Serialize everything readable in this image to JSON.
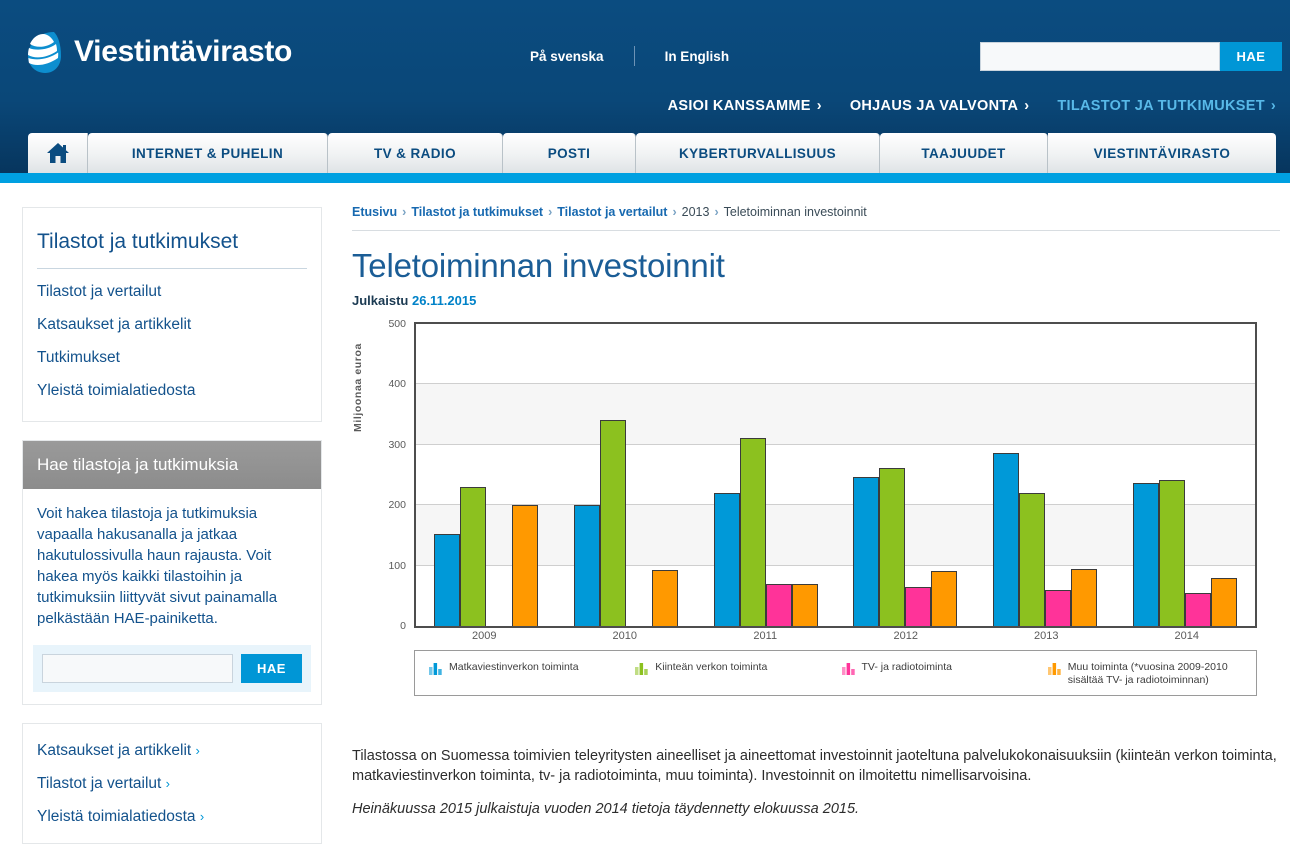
{
  "header": {
    "brand": "Viestintävirasto",
    "lang_sv": "På svenska",
    "lang_en": "In English",
    "search_placeholder": "",
    "search_value": "",
    "search_button": "HAE",
    "topnav": [
      {
        "label": "ASIOI KANSSAMME",
        "chev": "›",
        "active": false
      },
      {
        "label": "OHJAUS JA VALVONTA",
        "chev": "›",
        "active": false
      },
      {
        "label": "TILASTOT JA TUTKIMUKSET",
        "chev": "›",
        "active": true
      }
    ],
    "tabs": [
      {
        "label": "INTERNET & PUHELIN"
      },
      {
        "label": "TV & RADIO"
      },
      {
        "label": "POSTI"
      },
      {
        "label": "KYBERTURVALLISUUS"
      },
      {
        "label": "TAAJUUDET"
      },
      {
        "label": "VIESTINTÄVIRASTO"
      }
    ],
    "home_tab_name": "home-tab"
  },
  "sidebar": {
    "title": "Tilastot ja tutkimukset",
    "links": [
      "Tilastot ja vertailut",
      "Katsaukset ja artikkelit",
      "Tutkimukset",
      "Yleistä toimialatiedosta"
    ],
    "search_card": {
      "heading": "Hae tilastoja ja tutkimuksia",
      "description": "Voit hakea tilastoja ja tutkimuksia vapaalla hakusanalla ja jatkaa hakutulossivulla haun rajausta. Voit hakea myös kaikki tilastoihin ja tutkimuksiin liittyvät sivut painamalla pelkästään HAE-painiketta.",
      "input_value": "",
      "input_placeholder": "",
      "button": "HAE"
    },
    "quick_links": [
      {
        "label": "Katsaukset ja artikkelit",
        "arrow": "›"
      },
      {
        "label": "Tilastot ja vertailut",
        "arrow": "›"
      },
      {
        "label": "Yleistä toimialatiedosta",
        "arrow": "›"
      }
    ]
  },
  "content": {
    "breadcrumb": [
      {
        "label": "Etusivu",
        "link": true
      },
      {
        "label": "Tilastot ja tutkimukset",
        "link": true
      },
      {
        "label": "Tilastot ja vertailut",
        "link": true
      },
      {
        "label": "2013",
        "link": false
      },
      {
        "label": "Teletoiminnan investoinnit",
        "link": false
      }
    ],
    "breadcrumb_sep": "›",
    "title": "Teletoiminnan investoinnit",
    "published_label": "Julkaistu",
    "published_date": "26.11.2015",
    "paragraph": "Tilastossa on Suomessa toimivien teleyritysten aineelliset ja aineettomat investoinnit jaoteltuna palvelukokonaisuuksiin (kiinteän verkon toiminta, matkaviestinverkon toiminta, tv- ja radiotoiminta, muu toiminta). Investoinnit on ilmoitettu nimellisarvoisina.",
    "note": "Heinäkuussa 2015 julkaistuja vuoden 2014 tietoja täydennetty elokuussa 2015."
  },
  "chart_data": {
    "type": "bar",
    "title": "",
    "xlabel": "",
    "ylabel": "Miljoonaa euroa",
    "categories": [
      "2009",
      "2010",
      "2011",
      "2012",
      "2013",
      "2014"
    ],
    "ylim": [
      0,
      500
    ],
    "yticks": [
      0,
      100,
      200,
      300,
      400,
      500
    ],
    "ytick_labels": [
      "0",
      "100",
      "200",
      "300",
      "400",
      "500"
    ],
    "grid": true,
    "legend_position": "bottom",
    "series": [
      {
        "name": "Matkaviestinverkon toiminta",
        "color": "#0099d8",
        "values": [
          152,
          200,
          220,
          247,
          287,
          236
        ]
      },
      {
        "name": "Kiinteän verkon toiminta",
        "color": "#8cc11f",
        "values": [
          230,
          341,
          311,
          262,
          220,
          241
        ]
      },
      {
        "name": "TV- ja radiotoiminta",
        "color": "#ff3399",
        "values": [
          null,
          null,
          69,
          65,
          60,
          55
        ]
      },
      {
        "name": "Muu toiminta (*vuosina 2009-2010 sisältää TV- ja radiotoiminnan)",
        "color": "#ff9900",
        "values": [
          200,
          92,
          69,
          91,
          95,
          80
        ]
      }
    ]
  },
  "colors": {
    "brand_dark_blue": "#0b4c80",
    "accent_blue": "#0096d6",
    "link_blue": "#13528c",
    "bar_blue": "#0099d8",
    "bar_green": "#8cc11f",
    "bar_pink": "#ff3399",
    "bar_orange": "#ff9900"
  }
}
